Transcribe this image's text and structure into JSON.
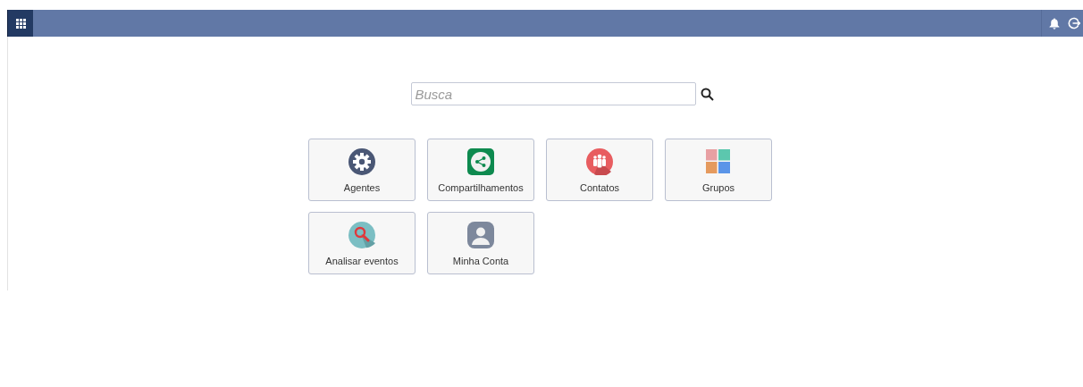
{
  "search": {
    "placeholder": "Busca"
  },
  "tiles": [
    {
      "label": "Agentes",
      "kind": "gear"
    },
    {
      "label": "Compartilhamentos",
      "kind": "share"
    },
    {
      "label": "Contatos",
      "kind": "people"
    },
    {
      "label": "Grupos",
      "kind": "groups"
    },
    {
      "label": "Analisar eventos",
      "kind": "magnifier"
    },
    {
      "label": "Minha Conta",
      "kind": "account"
    }
  ]
}
